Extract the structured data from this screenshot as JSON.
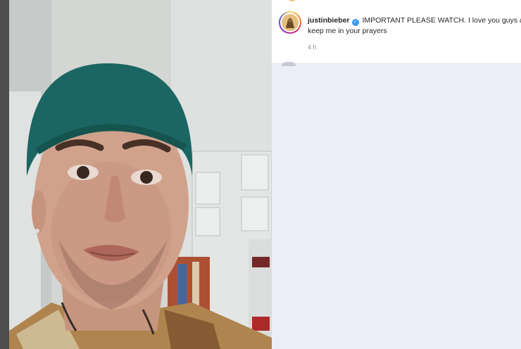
{
  "post": {
    "username": "justinbieber",
    "verified_symbol": "✓",
    "caption_line1": "IMPORTANT PLEASE WATCH. I love you guys and",
    "caption_line2": "keep me in your prayers",
    "timestamp": "4 h"
  },
  "colors": {
    "panel_background": "#ededf8",
    "verified_badge": "#3897f0",
    "beanie": "#1d6b66"
  },
  "icons": {
    "avatar": "profile-avatar-icon",
    "verified": "verified-badge-icon"
  }
}
